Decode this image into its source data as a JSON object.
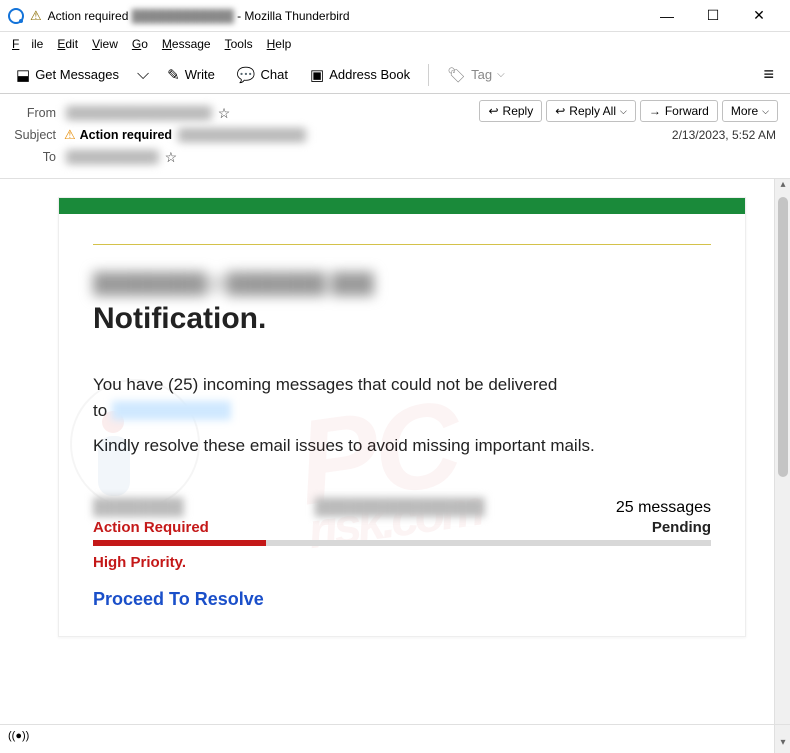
{
  "window": {
    "title_prefix": "Action required",
    "title_blur": "████████████",
    "title_suffix": " - Mozilla Thunderbird"
  },
  "menu": {
    "file": "File",
    "edit": "Edit",
    "view": "View",
    "go": "Go",
    "message": "Message",
    "tools": "Tools",
    "help": "Help"
  },
  "toolbar": {
    "get_messages": "Get Messages",
    "write": "Write",
    "chat": "Chat",
    "address_book": "Address Book",
    "tag": "Tag"
  },
  "header": {
    "from_label": "From",
    "from_value": "████████████████",
    "subject_label": "Subject",
    "subject_value": "Action required",
    "subject_blur": "██████████████",
    "to_label": "To",
    "to_value": "██████████",
    "date": "2/13/2023, 5:52 AM",
    "reply": "Reply",
    "reply_all": "Reply All",
    "forward": "Forward",
    "more": "More"
  },
  "email": {
    "blur_address": "████████@███████.███",
    "title": "Notification.",
    "line1a": "You have (25) incoming messages that could not be delivered",
    "line1b": "to",
    "line2": "Kindly resolve these email issues to avoid missing important mails.",
    "left_blur": "████████",
    "mid_blur": "███████████████",
    "count_text": "25 messages",
    "action_required": "Action Required",
    "pending": "Pending",
    "priority": "High Priority.",
    "proceed": "Proceed To Resolve"
  },
  "status": {
    "online_icon": "((●))"
  }
}
